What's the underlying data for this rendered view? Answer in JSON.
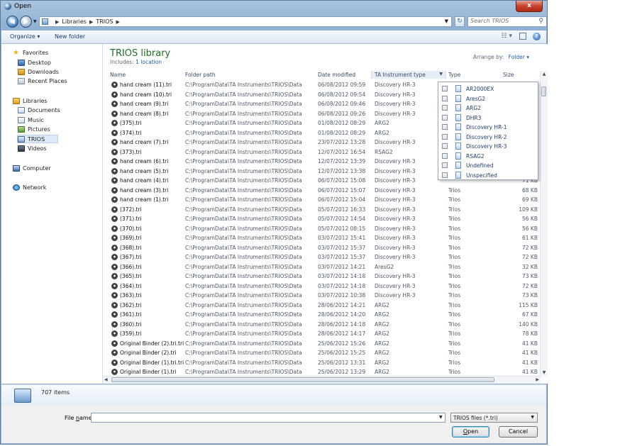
{
  "window": {
    "title": "Open",
    "close_label": "x"
  },
  "address": {
    "crumbs": [
      "Libraries",
      "TRIOS"
    ]
  },
  "search": {
    "placeholder": "Search TRIOS"
  },
  "toolbar": {
    "organize": "Organize ▾",
    "new_folder": "New folder"
  },
  "nav": {
    "favorites": "Favorites",
    "desktop": "Desktop",
    "downloads": "Downloads",
    "recent": "Recent Places",
    "libraries": "Libraries",
    "documents": "Documents",
    "music": "Music",
    "pictures": "Pictures",
    "trios": "TRIOS",
    "videos": "Videos",
    "computer": "Computer",
    "network": "Network"
  },
  "library": {
    "title": "TRIOS library",
    "includes_label": "Includes:",
    "includes_link": "1 location",
    "arrange_label": "Arrange by:",
    "arrange_value": "Folder ▾"
  },
  "columns": {
    "name": "Name",
    "path": "Folder path",
    "date": "Date modified",
    "instrument": "TA Instrument type",
    "type": "Type",
    "size": "Size"
  },
  "files": [
    {
      "name": "hand cream (11).tri",
      "path": "C:\\ProgramData\\TA Instruments\\TRIOS\\Data",
      "date": "06/08/2012 09:59",
      "inst": "Discovery HR-3",
      "type": "",
      "size": ""
    },
    {
      "name": "hand cream (10).tri",
      "path": "C:\\ProgramData\\TA Instruments\\TRIOS\\Data",
      "date": "06/08/2012 09:54",
      "inst": "Discovery HR-3",
      "type": "",
      "size": ""
    },
    {
      "name": "hand cream (9).tri",
      "path": "C:\\ProgramData\\TA Instruments\\TRIOS\\Data",
      "date": "06/08/2012 09:46",
      "inst": "Discovery HR-3",
      "type": "",
      "size": ""
    },
    {
      "name": "hand cream (8).tri",
      "path": "C:\\ProgramData\\TA Instruments\\TRIOS\\Data",
      "date": "06/08/2012 09:26",
      "inst": "Discovery HR-3",
      "type": "",
      "size": ""
    },
    {
      "name": "(375).tri",
      "path": "C:\\ProgramData\\TA Instruments\\TRIOS\\Data",
      "date": "01/08/2012 08:29",
      "inst": "ARG2",
      "type": "",
      "size": ""
    },
    {
      "name": "(374).tri",
      "path": "C:\\ProgramData\\TA Instruments\\TRIOS\\Data",
      "date": "01/08/2012 08:29",
      "inst": "ARG2",
      "type": "",
      "size": ""
    },
    {
      "name": "hand cream (7).tri",
      "path": "C:\\ProgramData\\TA Instruments\\TRIOS\\Data",
      "date": "23/07/2012 13:28",
      "inst": "Discovery HR-3",
      "type": "",
      "size": ""
    },
    {
      "name": "(373).tri",
      "path": "C:\\ProgramData\\TA Instruments\\TRIOS\\Data",
      "date": "12/07/2012 16:54",
      "inst": "RSAG2",
      "type": "",
      "size": ""
    },
    {
      "name": "hand cream (6).tri",
      "path": "C:\\ProgramData\\TA Instruments\\TRIOS\\Data",
      "date": "12/07/2012 13:39",
      "inst": "Discovery HR-3",
      "type": "",
      "size": ""
    },
    {
      "name": "hand cream (5).tri",
      "path": "C:\\ProgramData\\TA Instruments\\TRIOS\\Data",
      "date": "12/07/2012 13:38",
      "inst": "Discovery HR-3",
      "type": "",
      "size": ""
    },
    {
      "name": "hand cream (4).tri",
      "path": "C:\\ProgramData\\TA Instruments\\TRIOS\\Data",
      "date": "06/07/2012 15:08",
      "inst": "Discovery HR-3",
      "type": "",
      "size": "71 KB"
    },
    {
      "name": "hand cream (3).tri",
      "path": "C:\\ProgramData\\TA Instruments\\TRIOS\\Data",
      "date": "06/07/2012 15:07",
      "inst": "Discovery HR-3",
      "type": "Trios",
      "size": "68 KB"
    },
    {
      "name": "hand cream (1).tri",
      "path": "C:\\ProgramData\\TA Instruments\\TRIOS\\Data",
      "date": "06/07/2012 15:04",
      "inst": "Discovery HR-3",
      "type": "Trios",
      "size": "69 KB"
    },
    {
      "name": "(372).tri",
      "path": "C:\\ProgramData\\TA Instruments\\TRIOS\\Data",
      "date": "05/07/2012 16:33",
      "inst": "Discovery HR-3",
      "type": "Trios",
      "size": "109 KB"
    },
    {
      "name": "(371).tri",
      "path": "C:\\ProgramData\\TA Instruments\\TRIOS\\Data",
      "date": "05/07/2012 14:54",
      "inst": "Discovery HR-3",
      "type": "Trios",
      "size": "56 KB"
    },
    {
      "name": "(370).tri",
      "path": "C:\\ProgramData\\TA Instruments\\TRIOS\\Data",
      "date": "05/07/2012 08:15",
      "inst": "Discovery HR-3",
      "type": "Trios",
      "size": "56 KB"
    },
    {
      "name": "(369).tri",
      "path": "C:\\ProgramData\\TA Instruments\\TRIOS\\Data",
      "date": "03/07/2012 15:41",
      "inst": "Discovery HR-3",
      "type": "Trios",
      "size": "61 KB"
    },
    {
      "name": "(368).tri",
      "path": "C:\\ProgramData\\TA Instruments\\TRIOS\\Data",
      "date": "03/07/2012 15:37",
      "inst": "Discovery HR-3",
      "type": "Trios",
      "size": "72 KB"
    },
    {
      "name": "(367).tri",
      "path": "C:\\ProgramData\\TA Instruments\\TRIOS\\Data",
      "date": "03/07/2012 15:37",
      "inst": "Discovery HR-3",
      "type": "Trios",
      "size": "72 KB"
    },
    {
      "name": "(366).tri",
      "path": "C:\\ProgramData\\TA Instruments\\TRIOS\\Data",
      "date": "03/07/2012 14:21",
      "inst": "AresG2",
      "type": "Trios",
      "size": "32 KB"
    },
    {
      "name": "(365).tri",
      "path": "C:\\ProgramData\\TA Instruments\\TRIOS\\Data",
      "date": "03/07/2012 14:18",
      "inst": "Discovery HR-3",
      "type": "Trios",
      "size": "73 KB"
    },
    {
      "name": "(364).tri",
      "path": "C:\\ProgramData\\TA Instruments\\TRIOS\\Data",
      "date": "03/07/2012 14:18",
      "inst": "Discovery HR-3",
      "type": "Trios",
      "size": "72 KB"
    },
    {
      "name": "(363).tri",
      "path": "C:\\ProgramData\\TA Instruments\\TRIOS\\Data",
      "date": "03/07/2012 10:38",
      "inst": "Discovery HR-3",
      "type": "Trios",
      "size": "73 KB"
    },
    {
      "name": "(362).tri",
      "path": "C:\\ProgramData\\TA Instruments\\TRIOS\\Data",
      "date": "28/06/2012 14:21",
      "inst": "ARG2",
      "type": "Trios",
      "size": "115 KB"
    },
    {
      "name": "(361).tri",
      "path": "C:\\ProgramData\\TA Instruments\\TRIOS\\Data",
      "date": "28/06/2012 14:20",
      "inst": "ARG2",
      "type": "Trios",
      "size": "67 KB"
    },
    {
      "name": "(360).tri",
      "path": "C:\\ProgramData\\TA Instruments\\TRIOS\\Data",
      "date": "28/06/2012 14:18",
      "inst": "ARG2",
      "type": "Trios",
      "size": "140 KB"
    },
    {
      "name": "(359).tri",
      "path": "C:\\ProgramData\\TA Instruments\\TRIOS\\Data",
      "date": "28/06/2012 14:17",
      "inst": "ARG2",
      "type": "Trios",
      "size": "78 KB"
    },
    {
      "name": "Original Binder (2).tri.tri",
      "path": "C:\\ProgramData\\TA Instruments\\TRIOS\\Data",
      "date": "25/06/2012 15:26",
      "inst": "ARG2",
      "type": "Trios",
      "size": "41 KB"
    },
    {
      "name": "Original Binder (2).tri",
      "path": "C:\\ProgramData\\TA Instruments\\TRIOS\\Data",
      "date": "25/06/2012 15:25",
      "inst": "ARG2",
      "type": "Trios",
      "size": "41 KB"
    },
    {
      "name": "Original Binder (1).tri.tri",
      "path": "C:\\ProgramData\\TA Instruments\\TRIOS\\Data",
      "date": "25/06/2012 13:31",
      "inst": "ARG2",
      "type": "Trios",
      "size": "41 KB"
    },
    {
      "name": "Original Binder (1).tri",
      "path": "C:\\ProgramData\\TA Instruments\\TRIOS\\Data",
      "date": "25/06/2012 13:29",
      "inst": "ARG2",
      "type": "Trios",
      "size": "41 KB"
    }
  ],
  "filter_options": [
    "AR2000EX",
    "AresG2",
    "ARG2",
    "DHR3",
    "Discovery HR-1",
    "Discovery HR-2",
    "Discovery HR-3",
    "RSAG2",
    "Undefined",
    "Unspecified"
  ],
  "details": {
    "count": "707 items"
  },
  "footer": {
    "file_name_prefix": "File ",
    "file_name_underlined": "n",
    "file_name_suffix": "ame:",
    "file_name_value": "",
    "file_type": "TRIOS files (*.tri)",
    "open_underlined": "O",
    "open_rest": "pen",
    "cancel": "Cancel"
  }
}
